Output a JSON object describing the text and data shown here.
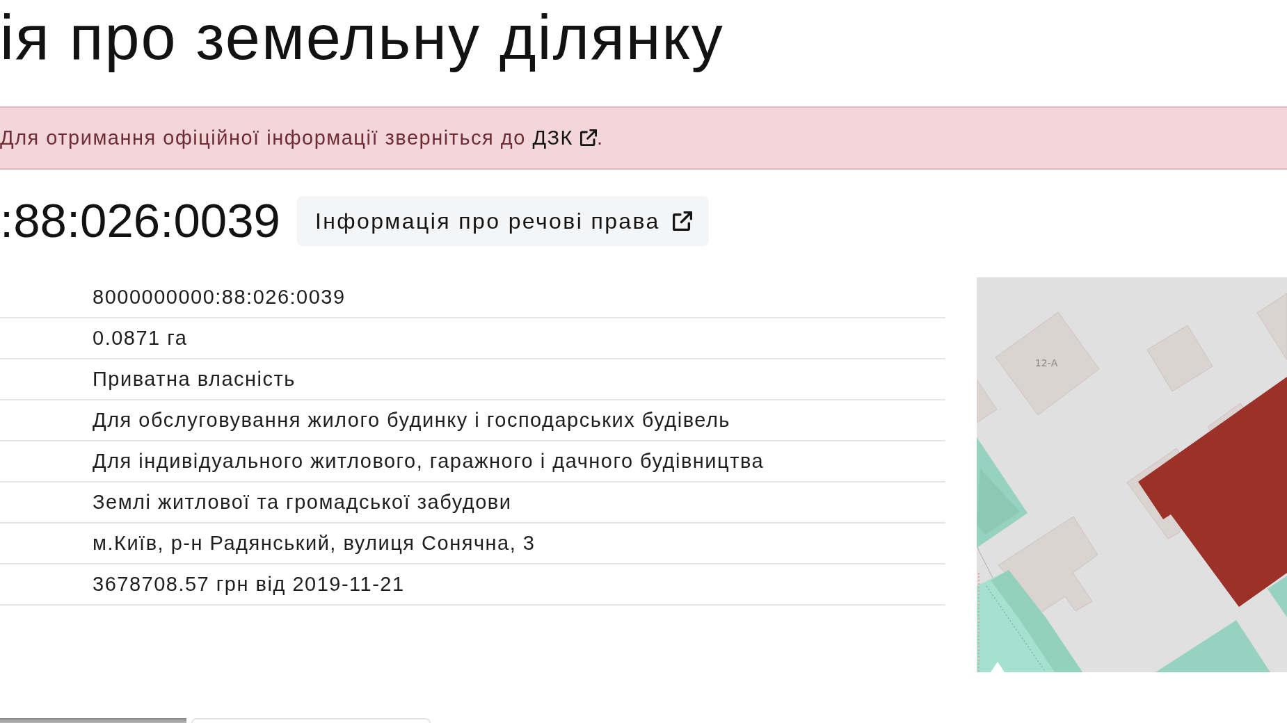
{
  "title": "ія про земельну ділянку",
  "alert": {
    "text": "Для отримання офіційної інформації зверніться до",
    "link": "ДЗК",
    "end": "."
  },
  "parcel": {
    "number": ":88:026:0039",
    "rights_button": "Інформація про речові права"
  },
  "table": {
    "rows": [
      {
        "value": "8000000000:88:026:0039"
      },
      {
        "value": "0.0871 га"
      },
      {
        "value": "Приватна власність"
      },
      {
        "value": "Для обслуговування жилого будинку і господарських будівель"
      },
      {
        "value": "Для індивідуального житлового, гаражного і дачного будівництва"
      },
      {
        "value": "Землі житлової та громадської забудови"
      },
      {
        "value": "м.Київ, р-н Радянський, вулиця Сонячна, 3"
      },
      {
        "value": "3678708.57 грн від 2019-11-21"
      }
    ]
  },
  "map": {
    "labels": [
      "12-А"
    ]
  }
}
